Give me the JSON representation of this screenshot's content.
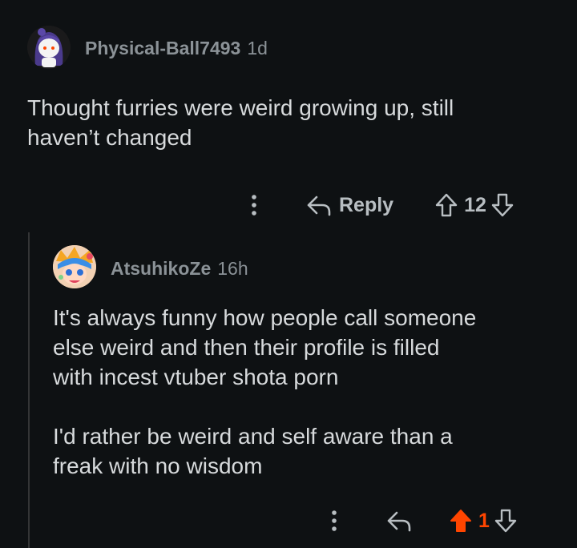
{
  "comments": [
    {
      "username": "Physical-Ball7493",
      "age": "1d",
      "avatar_icon": "reddit-snoo-avatar-icon",
      "body": [
        "Thought furries were weird growing up, still",
        "haven’t changed"
      ],
      "actions": {
        "more_icon": "more-vertical-icon",
        "reply_icon": "reply-arrow-icon",
        "reply_label": "Reply",
        "upvote_icon": "upvote-arrow-icon",
        "score": "12",
        "downvote_icon": "downvote-arrow-icon"
      }
    },
    {
      "username": "AtsuhikoZe",
      "age": "16h",
      "avatar_icon": "anime-character-avatar-icon",
      "body": [
        "It's always funny how people call someone",
        "else weird and then their profile is filled",
        "with incest vtuber shota porn",
        "",
        "I'd rather be weird and self aware than a",
        "freak with no wisdom"
      ],
      "actions": {
        "more_icon": "more-vertical-icon",
        "reply_icon": "reply-arrow-icon",
        "upvote_icon": "upvote-arrow-filled-icon",
        "score": "1",
        "score_color": "#ff4500",
        "downvote_icon": "downvote-arrow-icon"
      }
    }
  ],
  "colors": {
    "background": "#0e1113",
    "text": "#d7dadc",
    "meta": "#8b9297",
    "upvoted": "#ff4500",
    "thread_line": "#343536"
  }
}
